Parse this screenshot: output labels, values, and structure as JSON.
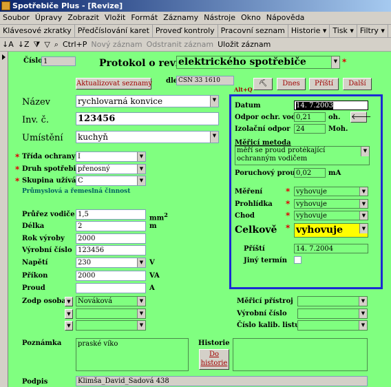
{
  "window": {
    "title": "Spotřebiče Plus - [Revize]"
  },
  "menu": [
    "Soubor",
    "Úpravy",
    "Zobrazit",
    "Vložit",
    "Formát",
    "Záznamy",
    "Nástroje",
    "Okno",
    "Nápověda"
  ],
  "toolbar1": [
    "Klávesové zkratky",
    "Předčíslování karet",
    "Proveď kontroly",
    "Pracovní seznam",
    "Historie ▾",
    "Tisk ▾",
    "Filtry ▾"
  ],
  "toolbar2": {
    "ctrlp": "Ctrl+P",
    "new": "Nový záznam",
    "delete": "Odstranit záznam",
    "save": "Uložit záznam"
  },
  "form": {
    "cislo_label": "Číslo",
    "cislo": "1",
    "title": "Protokol o revizi",
    "title_type": "elektrického spotřebiče",
    "update_btn": "Aktualizovat seznamy",
    "dle_label": "dle",
    "dle": "ČSN 33 1610",
    "altq": "Alt+Q",
    "dnes_btn": "Dnes",
    "pristi_btn": "Příští",
    "dalsi_btn": "Další",
    "nazev_label": "Název",
    "nazev": "rychlovarná konvice",
    "inv_label": "Inv. č.",
    "inv": "123456",
    "umisteni_label": "Umístění",
    "umisteni": "kuchyň",
    "trida_label": "Třída ochrany",
    "trida": "I",
    "druh_label": "Druh spotřebiče",
    "druh": "přenosný",
    "skupina_label": "Skupina užívání",
    "skupina": "C",
    "skupina_desc": "Průmyslová a řemeslná činnost",
    "prurez_label": "Průřez vodiče",
    "prurez": "1,5",
    "prurez_unit": "mm",
    "prurez_sup": "2",
    "delka_label": "Délka",
    "delka": "2",
    "delka_unit": "m",
    "rok_label": "Rok výroby",
    "rok": "2000",
    "vyrobni_label": "Výrobní číslo",
    "vyrobni": "123456",
    "napeti_label": "Napětí",
    "napeti": "230",
    "napeti_unit": "V",
    "prikon_label": "Příkon",
    "prikon": "2000",
    "prikon_unit": "VA",
    "proud_label": "Proud",
    "proud": "",
    "proud_unit": "A",
    "zodp_label": "Zodp osoba",
    "zodp": "Nováková",
    "poznamka_label": "Poznámka",
    "poznamka": "praské víko",
    "historie_label": "Historie",
    "do_historie_btn": "Do historie",
    "podpis_label": "Podpis",
    "podpis": "Klimša_David_Sadová 438",
    "meric_label": "Měřicí přístroj",
    "vyr_cislo_label": "Výrobní číslo",
    "kalib_label": "Číslo kalib. listu"
  },
  "measure": {
    "datum_label": "Datum",
    "datum": "14. 7.2003",
    "odpor_label": "Odpor ochr. vodiče",
    "odpor": "0,21",
    "odpor_unit": "oh.",
    "izolacni_label": "Izolační odpor",
    "izolacni": "24",
    "izolacni_unit": "Moh.",
    "metoda_label": "Měřicí metoda",
    "metoda": "měří se proud protékající ochranným vodičem",
    "poruch_label": "Poruchový proud",
    "poruch": "0,02",
    "poruch_unit": "mA",
    "mereni_label": "Měření",
    "mereni": "vyhovuje",
    "prohlidka_label": "Prohlídka",
    "prohlidka": "vyhovuje",
    "chod_label": "Chod",
    "chod": "vyhovuje",
    "celkove_label": "Celkově",
    "celkove": "vyhovuje",
    "pristi_label": "Příští",
    "pristi": "14. 7.2004",
    "jiny_label": "Jiný termín"
  },
  "colors": {
    "form_bg": "#80ff80",
    "frame": "#1a2bd4",
    "accent": "#a00000",
    "highlight": "#ffff00"
  }
}
